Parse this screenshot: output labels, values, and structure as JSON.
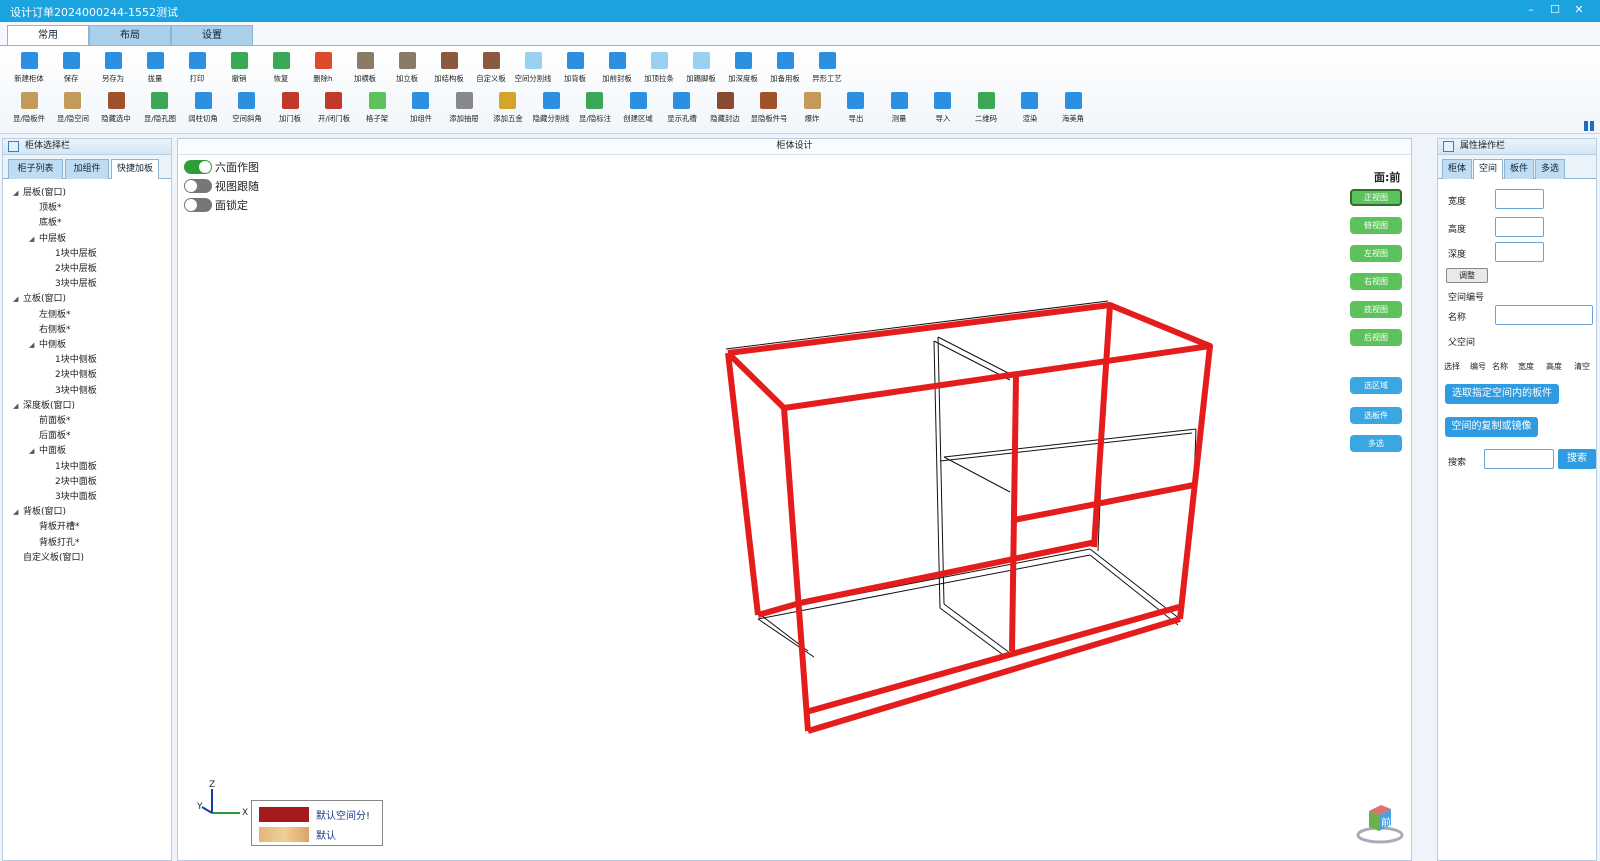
{
  "window": {
    "title": "设计订单2024000244-1552测试",
    "minimize": "–",
    "maximize": "☐",
    "close": "✕"
  },
  "tabs": [
    {
      "label": "常用"
    },
    {
      "label": "布局"
    },
    {
      "label": "设置"
    }
  ],
  "toolbar": {
    "row1": [
      {
        "label": "新建柜体",
        "icon": "new-cabinet-icon",
        "color": "#2c8fe0"
      },
      {
        "label": "保存",
        "icon": "save-icon",
        "color": "#2c8fe0"
      },
      {
        "label": "另存为",
        "icon": "save-as-icon",
        "color": "#2c8fe0"
      },
      {
        "label": "拢量",
        "icon": "measure-icon",
        "color": "#2c8fe0"
      },
      {
        "label": "打印",
        "icon": "print-icon",
        "color": "#2c8fe0"
      },
      {
        "label": "撤销",
        "icon": "undo-icon",
        "color": "#3aa857"
      },
      {
        "label": "恢复",
        "icon": "redo-icon",
        "color": "#3aa857"
      },
      {
        "label": "删除h",
        "icon": "delete-icon",
        "color": "#e04a2c"
      },
      {
        "label": "加横板",
        "icon": "horizontal-board-icon",
        "color": "#8a7a68"
      },
      {
        "label": "加立板",
        "icon": "vertical-board-icon",
        "color": "#8a7a68"
      },
      {
        "label": "加结构板",
        "icon": "structure-board-icon",
        "color": "#8a5a40"
      },
      {
        "label": "自定义板",
        "icon": "custom-board-icon",
        "color": "#8a5a40"
      },
      {
        "label": "空间分割线",
        "icon": "split-line-icon",
        "color": "#9ad0f0"
      },
      {
        "label": "加背板",
        "icon": "back-board-icon",
        "color": "#2c8fe0"
      },
      {
        "label": "加前封板",
        "icon": "front-seal-icon",
        "color": "#2c8fe0"
      },
      {
        "label": "加顶拉条",
        "icon": "top-strip-icon",
        "color": "#9ad0f0"
      },
      {
        "label": "加踢脚板",
        "icon": "kick-board-icon",
        "color": "#9ad0f0"
      },
      {
        "label": "加深度板",
        "icon": "depth-board-icon",
        "color": "#2c8fe0"
      },
      {
        "label": "加备用板",
        "icon": "spare-board-icon",
        "color": "#2c8fe0"
      },
      {
        "label": "异形工艺",
        "icon": "irregular-craft-icon",
        "color": "#2c8fe0"
      }
    ],
    "row2": [
      {
        "label": "显/隐板件",
        "icon": "toggle-board-icon",
        "color": "#c49a5a"
      },
      {
        "label": "显/隐空间",
        "icon": "toggle-space-icon",
        "color": "#c49a5a"
      },
      {
        "label": "隐藏选中",
        "icon": "hide-selected-icon",
        "color": "#a0522d"
      },
      {
        "label": "显/隐孔图",
        "icon": "toggle-hole-icon",
        "color": "#3aa857"
      },
      {
        "label": "阔柱切角",
        "icon": "column-cut-icon",
        "color": "#2c8fe0"
      },
      {
        "label": "空间斜角",
        "icon": "space-bevel-icon",
        "color": "#2c8fe0"
      },
      {
        "label": "加门板",
        "icon": "door-board-icon",
        "color": "#c0392b"
      },
      {
        "label": "开/闭门板",
        "icon": "open-door-icon",
        "color": "#c0392b"
      },
      {
        "label": "格子架",
        "icon": "grid-rack-icon",
        "color": "#5dc25c"
      },
      {
        "label": "加组件",
        "icon": "add-component-icon",
        "color": "#2c8fe0"
      },
      {
        "label": "添加抽屉",
        "icon": "drawer-icon",
        "color": "#888888"
      },
      {
        "label": "添加五金",
        "icon": "hardware-icon",
        "color": "#d4a52a"
      },
      {
        "label": "隐藏分割线",
        "icon": "hide-split-icon",
        "color": "#2c8fe0"
      },
      {
        "label": "显/隐标注",
        "icon": "toggle-dim-icon",
        "color": "#3aa857"
      },
      {
        "label": "创建区域",
        "icon": "create-region-icon",
        "color": "#2c8fe0"
      },
      {
        "label": "显示孔槽",
        "icon": "show-groove-icon",
        "color": "#2c8fe0"
      },
      {
        "label": "隐藏封边",
        "icon": "hide-edge-icon",
        "color": "#8a4a30"
      },
      {
        "label": "显隐板件号",
        "icon": "board-number-icon",
        "color": "#a0522d"
      },
      {
        "label": "爆炸",
        "icon": "explode-icon",
        "color": "#c49a5a"
      },
      {
        "label": "导出",
        "icon": "export-icon",
        "color": "#2c8fe0"
      },
      {
        "label": "测量",
        "icon": "ruler-icon",
        "color": "#2c8fe0"
      },
      {
        "label": "导入",
        "icon": "import-icon",
        "color": "#2c8fe0"
      },
      {
        "label": "二维码",
        "icon": "qrcode-icon",
        "color": "#3aa857"
      },
      {
        "label": "渲染",
        "icon": "render-icon",
        "color": "#2c8fe0"
      },
      {
        "label": "海美角",
        "icon": "corner-icon",
        "color": "#2c8fe0"
      }
    ]
  },
  "left_panel": {
    "title": "柜体选择栏",
    "tabs": [
      {
        "label": "柜子列表"
      },
      {
        "label": "加组件"
      },
      {
        "label": "快捷加板"
      }
    ],
    "tree": [
      {
        "label": "层板(窗口)",
        "level": 0,
        "expander": "◢"
      },
      {
        "label": "顶板*",
        "level": 1,
        "expander": ""
      },
      {
        "label": "底板*",
        "level": 1,
        "expander": ""
      },
      {
        "label": "中层板",
        "level": 1,
        "expander": "◢"
      },
      {
        "label": "1块中层板",
        "level": 2,
        "expander": ""
      },
      {
        "label": "2块中层板",
        "level": 2,
        "expander": ""
      },
      {
        "label": "3块中层板",
        "level": 2,
        "expander": ""
      },
      {
        "label": "立板(窗口)",
        "level": 0,
        "expander": "◢"
      },
      {
        "label": "左侧板*",
        "level": 1,
        "expander": ""
      },
      {
        "label": "右侧板*",
        "level": 1,
        "expander": ""
      },
      {
        "label": "中侧板",
        "level": 1,
        "expander": "◢"
      },
      {
        "label": "1块中侧板",
        "level": 2,
        "expander": ""
      },
      {
        "label": "2块中侧板",
        "level": 2,
        "expander": ""
      },
      {
        "label": "3块中侧板",
        "level": 2,
        "expander": ""
      },
      {
        "label": "深度板(窗口)",
        "level": 0,
        "expander": "◢"
      },
      {
        "label": "前面板*",
        "level": 1,
        "expander": ""
      },
      {
        "label": "后面板*",
        "level": 1,
        "expander": ""
      },
      {
        "label": "中面板",
        "level": 1,
        "expander": "◢"
      },
      {
        "label": "1块中面板",
        "level": 2,
        "expander": ""
      },
      {
        "label": "2块中面板",
        "level": 2,
        "expander": ""
      },
      {
        "label": "3块中面板",
        "level": 2,
        "expander": ""
      },
      {
        "label": "背板(窗口)",
        "level": 0,
        "expander": "◢"
      },
      {
        "label": "背板开槽*",
        "level": 1,
        "expander": ""
      },
      {
        "label": "背板打孔*",
        "level": 1,
        "expander": ""
      },
      {
        "label": "自定义板(窗口)",
        "level": 0,
        "expander": ""
      }
    ]
  },
  "center": {
    "title": "柜体设计",
    "toggles": [
      {
        "label": "六面作图",
        "on": true
      },
      {
        "label": "视图跟随",
        "on": false
      },
      {
        "label": "面锁定",
        "on": false
      }
    ],
    "face_label": "面:前",
    "view_buttons": [
      {
        "label": "正视图",
        "selected": true
      },
      {
        "label": "俯视图",
        "selected": false
      },
      {
        "label": "左视图",
        "selected": false
      },
      {
        "label": "右视图",
        "selected": false
      },
      {
        "label": "底视图",
        "selected": false
      },
      {
        "label": "后视图",
        "selected": false
      }
    ],
    "select_buttons": [
      {
        "label": "选区域"
      },
      {
        "label": "选板件"
      },
      {
        "label": "多选"
      }
    ],
    "legend": [
      {
        "label": "默认空间分!",
        "color": "#a51a1a"
      },
      {
        "label": "默认",
        "color": "#e8c08a"
      }
    ],
    "axis": {
      "z": "Z",
      "y": "Y",
      "x": "X"
    },
    "nav_cube": "前",
    "model_color": "#e41c1c"
  },
  "right_panel": {
    "title": "属性操作栏",
    "tabs": [
      {
        "label": "柜体"
      },
      {
        "label": "空间"
      },
      {
        "label": "板件"
      },
      {
        "label": "多选"
      }
    ],
    "fields": [
      {
        "label": "宽度",
        "value": ""
      },
      {
        "label": "高度",
        "value": ""
      },
      {
        "label": "深度",
        "value": ""
      }
    ],
    "adjust_button": "调整",
    "space_number": "空间编号",
    "name_label": "名称",
    "name_value": "",
    "parent_label": "父空间",
    "columns": [
      "选择",
      "编号",
      "名称",
      "宽度",
      "高度",
      "清空"
    ],
    "select_button": "选取指定空间内的板件",
    "copy_button": "空间的复制或镜像",
    "search_label": "搜索",
    "search_value": "",
    "search_button": "搜索"
  }
}
